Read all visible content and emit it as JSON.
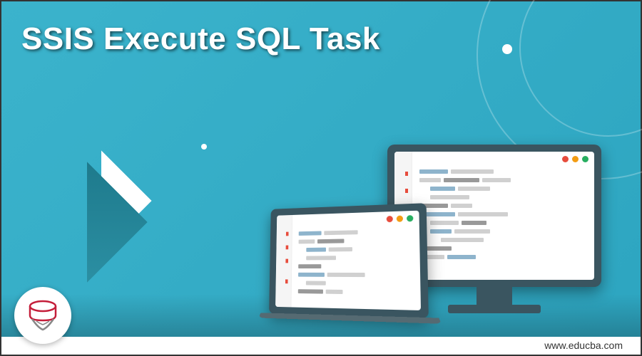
{
  "title": "SSIS Execute SQL Task",
  "website_url": "www.educba.com",
  "icon_name": "sql-server-database-icon"
}
